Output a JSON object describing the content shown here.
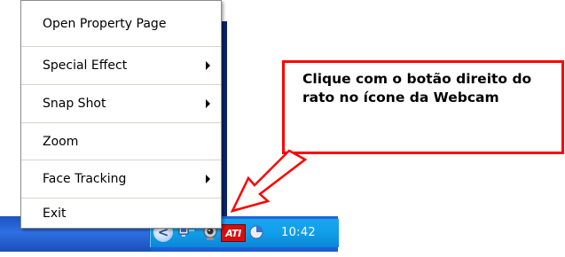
{
  "context_menu": {
    "items": [
      {
        "label": "Open Property Page",
        "has_submenu": false
      },
      {
        "label": "Special Effect",
        "has_submenu": true
      },
      {
        "label": "Snap Shot",
        "has_submenu": true
      },
      {
        "label": "Zoom",
        "has_submenu": false
      },
      {
        "label": "Face Tracking",
        "has_submenu": true
      },
      {
        "label": "Exit",
        "has_submenu": false
      }
    ]
  },
  "callout": {
    "text": "Clique com o botão direito do rato no ícone da Webcam",
    "border_color": "#ff0000"
  },
  "taskbar": {
    "tray_icons": [
      {
        "name": "show-hidden-icons",
        "glyph": "<"
      },
      {
        "name": "network-icon",
        "glyph": "▪"
      },
      {
        "name": "webcam-icon",
        "glyph": "●"
      },
      {
        "name": "ati-icon",
        "glyph": "ATI"
      },
      {
        "name": "volume-icon",
        "glyph": "◔"
      }
    ],
    "clock": "10:42"
  }
}
